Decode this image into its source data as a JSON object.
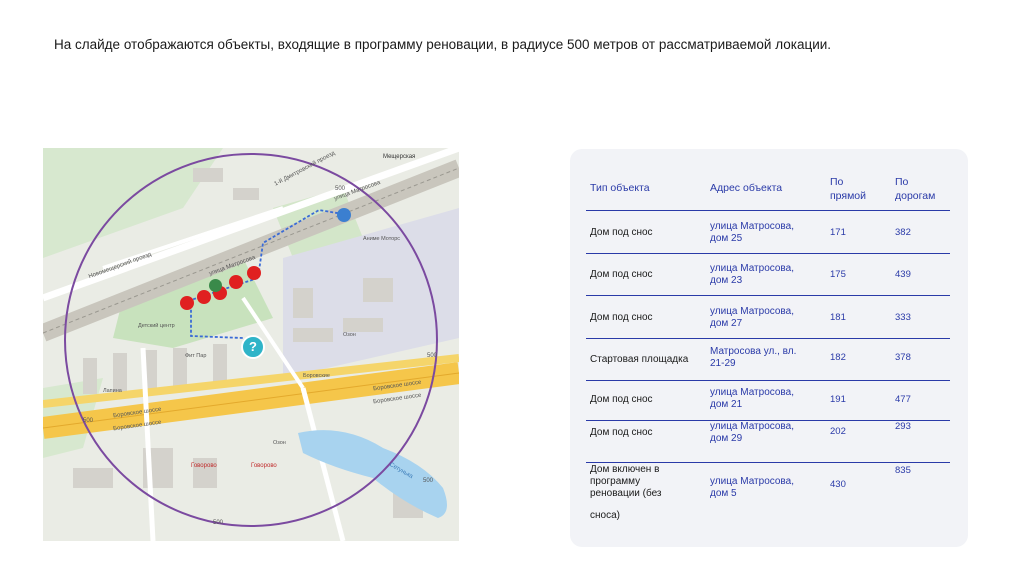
{
  "caption": "На слайде отображаются объекты, входящие в программу реновации, в радиусе 500 метров от рассматриваемой локации.",
  "map": {
    "roads": [
      "1-й Дмитровский проезд",
      "Новомещерский проезд",
      "улица Матросова",
      "улица Матросова",
      "Боровское шоссе",
      "Боровское шоссе",
      "Боровское шоссе",
      "Боровское шоссе"
    ],
    "places": [
      "Мещерская",
      "Аниме Моторс",
      "Детский центр",
      "Фит Пар",
      "Говорово",
      "Говорово",
      "Сетунька",
      "Озон",
      "Озон",
      "Лапина",
      "Боровские"
    ],
    "circle_labels": [
      "500",
      "500",
      "500",
      "500",
      "500"
    ],
    "marker_colors": [
      "#e02020",
      "#3a8a4a",
      "#3b7fd0",
      "#2fb4c8"
    ],
    "question_marker_icon": "?"
  },
  "table": {
    "headers": {
      "type": "Тип объекта",
      "address": "Адрес объекта",
      "straight": [
        "По",
        "прямой"
      ],
      "roads": [
        "По",
        "дорогам"
      ]
    },
    "rows": [
      {
        "type": [
          "Дом под снос"
        ],
        "address": [
          "улица Матросова,",
          "дом 25"
        ],
        "straight": "171",
        "roads": "382"
      },
      {
        "type": [
          "Дом под снос"
        ],
        "address": [
          "улица Матросова,",
          "дом 23"
        ],
        "straight": "175",
        "roads": "439"
      },
      {
        "type": [
          "Дом под снос"
        ],
        "address": [
          "улица Матросова,",
          "дом 27"
        ],
        "straight": "181",
        "roads": "333"
      },
      {
        "type": [
          "Стартовая площадка"
        ],
        "address": [
          "Матросова ул., вл.",
          "21-29"
        ],
        "straight": "182",
        "roads": "378"
      },
      {
        "type": [
          "Дом под снос"
        ],
        "address": [
          "улица Матросова,",
          "дом 21"
        ],
        "straight": "191",
        "roads": "477"
      },
      {
        "type": [
          "Дом под снос"
        ],
        "address": [
          "улица Матросова,",
          "дом 29"
        ],
        "straight": "202",
        "roads": "293"
      },
      {
        "type": [
          "Дом включен в",
          "программу",
          "реновации (без",
          "",
          "сноса)"
        ],
        "address": [
          "улица Матросова,",
          "дом 5"
        ],
        "straight": "430",
        "roads": "835"
      }
    ]
  }
}
